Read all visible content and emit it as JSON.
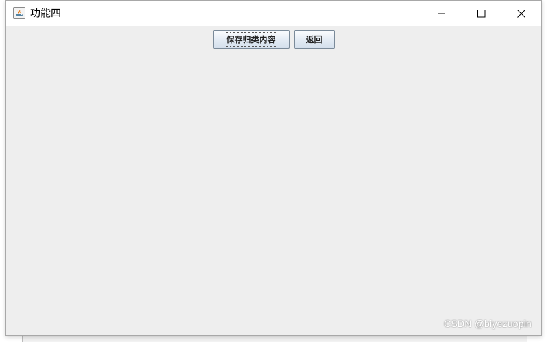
{
  "window": {
    "title": "功能四",
    "icon": "java-icon",
    "controls": [
      "minimize-icon",
      "maximize-icon",
      "close-icon"
    ]
  },
  "toolbar": {
    "save_label": "保存归类内容",
    "back_label": "返回"
  },
  "watermark": {
    "text": "CSDN @biyezuopin"
  },
  "colors": {
    "content_bg": "#eeeeee",
    "titlebar_bg": "#ffffff",
    "button_border": "#7a8a99"
  }
}
